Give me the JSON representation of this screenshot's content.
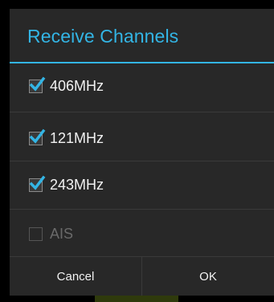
{
  "dialog": {
    "title": "Receive Channels",
    "accent_color": "#33b5e5",
    "options": [
      {
        "label": "406MHz",
        "checked": true,
        "enabled": true
      },
      {
        "label": "121MHz",
        "checked": true,
        "enabled": true
      },
      {
        "label": "243MHz",
        "checked": true,
        "enabled": true
      },
      {
        "label": "AIS",
        "checked": false,
        "enabled": false
      }
    ],
    "buttons": {
      "cancel_label": "Cancel",
      "ok_label": "OK"
    }
  },
  "icons": {
    "checked": "checkmark-icon",
    "unchecked": "empty-checkbox-icon"
  }
}
